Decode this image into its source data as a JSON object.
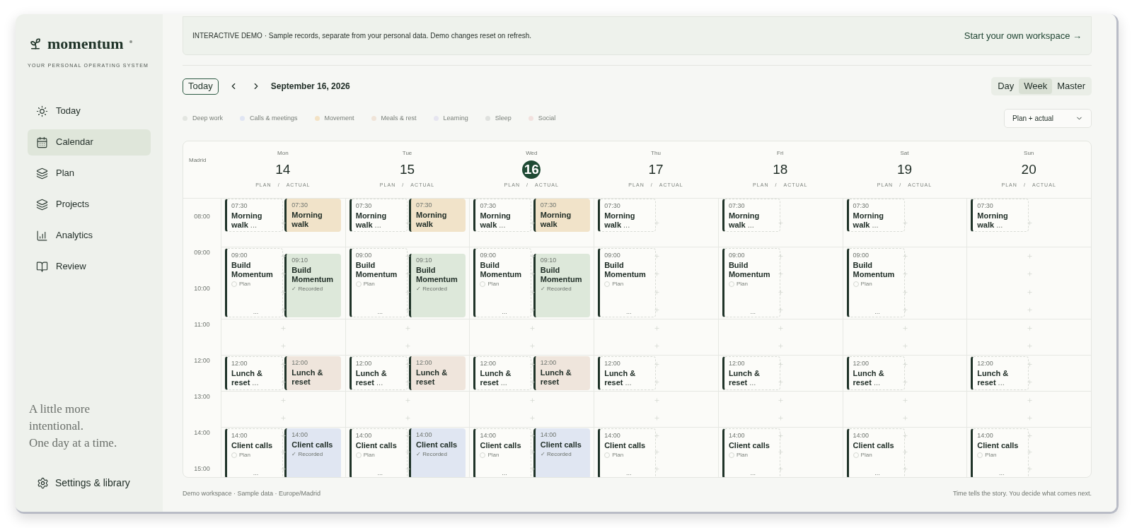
{
  "sidebar": {
    "logo": "momentum",
    "tagline": "YOUR PERSONAL OPERATING SYSTEM",
    "nav": [
      {
        "label": "Today",
        "selected": false
      },
      {
        "label": "Calendar",
        "selected": true
      },
      {
        "label": "Plan",
        "selected": false
      },
      {
        "label": "Projects",
        "selected": false
      },
      {
        "label": "Analytics",
        "selected": false
      },
      {
        "label": "Review",
        "selected": false
      }
    ],
    "quote": [
      "A little more",
      "intentional.",
      "One day at a time."
    ],
    "settings": "Settings & library"
  },
  "banner": {
    "text": "INTERACTIVE DEMO · Sample records, separate from your personal data. Demo changes reset on refresh.",
    "link": "Start your own workspace →"
  },
  "toolbar": {
    "today": "Today",
    "date": "September 16, 2026",
    "views": [
      {
        "label": "Day",
        "selected": false
      },
      {
        "label": "Week",
        "selected": true
      },
      {
        "label": "Master",
        "selected": false
      }
    ],
    "filter": "Plan + actual"
  },
  "legend": [
    {
      "label": "Deep work",
      "color": "#e3e6e1"
    },
    {
      "label": "Calls & meetings",
      "color": "#e0e5f3"
    },
    {
      "label": "Movement",
      "color": "#f3e2c4"
    },
    {
      "label": "Meals & rest",
      "color": "#f0e4d8"
    },
    {
      "label": "Learning",
      "color": "#e6e5f0"
    },
    {
      "label": "Sleep",
      "color": "#dfe1de"
    },
    {
      "label": "Social",
      "color": "#f2e1de"
    }
  ],
  "calendar": {
    "timezone": "Madrid",
    "times": [
      "08:00",
      "09:00",
      "10:00",
      "11:00",
      "12:00",
      "13:00",
      "14:00",
      "15:00"
    ],
    "days": [
      {
        "weekday": "Mon",
        "date": "14",
        "selected": false,
        "plan_label": "PLAN",
        "separator": "/",
        "actual_label": "ACTUAL",
        "rows": [
          {
            "plan": {
              "time": "07:30",
              "title": "Morning walk",
              "more": "..."
            },
            "actual": {
              "time": "07:30",
              "title": "Morning walk",
              "color": "#f1e3c9"
            }
          },
          {
            "plan": {
              "time": "09:00",
              "title": "Build Momentum",
              "status": "Plan",
              "more": "..."
            },
            "actual": {
              "time": "09:10",
              "title": "Build Momentum",
              "status": "✓ Recorded",
              "color": "#dde8da"
            }
          },
          {},
          {
            "plan": {
              "time": "12:00",
              "title": "Lunch & reset",
              "more": "..."
            },
            "actual": {
              "time": "12:00",
              "title": "Lunch & reset",
              "color": "#efe5dc"
            }
          },
          {},
          {
            "plan": {
              "time": "14:00",
              "title": "Client calls",
              "status": "Plan",
              "more": "..."
            },
            "actual": {
              "time": "14:00",
              "title": "Client calls",
              "status": "✓ Recorded",
              "color": "#e0e6f2"
            }
          }
        ]
      },
      {
        "weekday": "Tue",
        "date": "15",
        "selected": false,
        "plan_label": "PLAN",
        "separator": "/",
        "actual_label": "ACTUAL",
        "rows": [
          {
            "plan": {
              "time": "07:30",
              "title": "Morning walk",
              "more": "..."
            },
            "actual": {
              "time": "07:30",
              "title": "Morning walk",
              "color": "#f1e3c9"
            }
          },
          {
            "plan": {
              "time": "09:00",
              "title": "Build Momentum",
              "status": "Plan",
              "more": "..."
            },
            "actual": {
              "time": "09:10",
              "title": "Build Momentum",
              "status": "✓ Recorded",
              "color": "#dde8da"
            }
          },
          {},
          {
            "plan": {
              "time": "12:00",
              "title": "Lunch & reset",
              "more": "..."
            },
            "actual": {
              "time": "12:00",
              "title": "Lunch & reset",
              "color": "#efe5dc"
            }
          },
          {},
          {
            "plan": {
              "time": "14:00",
              "title": "Client calls",
              "status": "Plan",
              "more": "..."
            },
            "actual": {
              "time": "14:00",
              "title": "Client calls",
              "status": "✓ Recorded",
              "color": "#e0e6f2"
            }
          }
        ]
      },
      {
        "weekday": "Wed",
        "date": "16",
        "selected": true,
        "plan_label": "PLAN",
        "separator": "/",
        "actual_label": "ACTUAL",
        "rows": [
          {
            "plan": {
              "time": "07:30",
              "title": "Morning walk",
              "more": "..."
            },
            "actual": {
              "time": "07:30",
              "title": "Morning walk",
              "color": "#f1e3c9"
            }
          },
          {
            "plan": {
              "time": "09:00",
              "title": "Build Momentum",
              "status": "Plan",
              "more": "..."
            },
            "actual": {
              "time": "09:10",
              "title": "Build Momentum",
              "status": "✓ Recorded",
              "color": "#dde8da"
            }
          },
          {},
          {
            "plan": {
              "time": "12:00",
              "title": "Lunch & reset",
              "more": "..."
            },
            "actual": {
              "time": "12:00",
              "title": "Lunch & reset",
              "color": "#efe5dc"
            }
          },
          {},
          {
            "plan": {
              "time": "14:00",
              "title": "Client calls",
              "status": "Plan",
              "more": "..."
            },
            "actual": {
              "time": "14:00",
              "title": "Client calls",
              "status": "✓ Recorded",
              "color": "#e0e6f2"
            }
          }
        ]
      },
      {
        "weekday": "Thu",
        "date": "17",
        "selected": false,
        "plan_label": "PLAN",
        "separator": "/",
        "actual_label": "ACTUAL",
        "rows": [
          {
            "plan": {
              "time": "07:30",
              "title": "Morning walk",
              "more": "..."
            }
          },
          {
            "plan": {
              "time": "09:00",
              "title": "Build Momentum",
              "status": "Plan",
              "more": "..."
            }
          },
          {},
          {
            "plan": {
              "time": "12:00",
              "title": "Lunch & reset",
              "more": "..."
            }
          },
          {},
          {
            "plan": {
              "time": "14:00",
              "title": "Client calls",
              "status": "Plan",
              "more": "..."
            }
          }
        ]
      },
      {
        "weekday": "Fri",
        "date": "18",
        "selected": false,
        "plan_label": "PLAN",
        "separator": "/",
        "actual_label": "ACTUAL",
        "rows": [
          {
            "plan": {
              "time": "07:30",
              "title": "Morning walk",
              "more": "..."
            }
          },
          {
            "plan": {
              "time": "09:00",
              "title": "Build Momentum",
              "status": "Plan",
              "more": "..."
            }
          },
          {},
          {
            "plan": {
              "time": "12:00",
              "title": "Lunch & reset",
              "more": "..."
            }
          },
          {},
          {
            "plan": {
              "time": "14:00",
              "title": "Client calls",
              "status": "Plan",
              "more": "..."
            }
          }
        ]
      },
      {
        "weekday": "Sat",
        "date": "19",
        "selected": false,
        "plan_label": "PLAN",
        "separator": "/",
        "actual_label": "ACTUAL",
        "rows": [
          {
            "plan": {
              "time": "07:30",
              "title": "Morning walk",
              "more": "..."
            }
          },
          {
            "plan": {
              "time": "09:00",
              "title": "Build Momentum",
              "status": "Plan",
              "more": "..."
            }
          },
          {},
          {
            "plan": {
              "time": "12:00",
              "title": "Lunch & reset",
              "more": "..."
            }
          },
          {},
          {
            "plan": {
              "time": "14:00",
              "title": "Client calls",
              "status": "Plan",
              "more": "..."
            }
          }
        ]
      },
      {
        "weekday": "Sun",
        "date": "20",
        "selected": false,
        "plan_label": "PLAN",
        "separator": "/",
        "actual_label": "ACTUAL",
        "rows": [
          {
            "plan": {
              "time": "07:30",
              "title": "Morning walk",
              "more": "..."
            }
          },
          {},
          {},
          {
            "plan": {
              "time": "12:00",
              "title": "Lunch & reset",
              "more": "..."
            }
          },
          {},
          {
            "plan": {
              "time": "14:00",
              "title": "Client calls",
              "status": "Plan",
              "more": "..."
            }
          }
        ]
      }
    ]
  },
  "footer": {
    "left": "Demo workspace · Sample data · Europe/Madrid",
    "right": "Time tells the story. You decide what comes next."
  }
}
